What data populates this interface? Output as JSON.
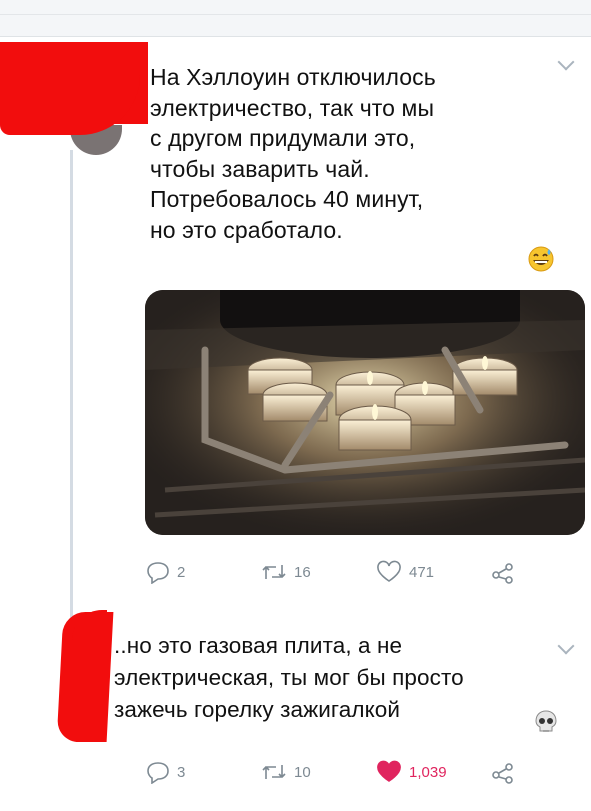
{
  "tweet1": {
    "text_lines": [
      "На Хэллоуин отключилось",
      "электричество, так что мы",
      "с другом придумали это,",
      "чтобы заварить чай.",
      "Потребовалось 40 минут,",
      "но это сработало."
    ],
    "emoji": "grinning-sweat-emoji",
    "stats": {
      "replies": "2",
      "retweets": "16",
      "likes": "471"
    }
  },
  "tweet2": {
    "text_lines": [
      "..но это газовая плита, а не",
      "электрическая, ты мог бы просто",
      "зажечь горелку зажигалкой"
    ],
    "emoji": "skull-emoji",
    "stats": {
      "replies": "3",
      "retweets": "10",
      "likes": "1,039"
    }
  },
  "colors": {
    "redaction": "#f20d0d",
    "like_active": "#e0245e",
    "icon_gray": "#7d8992"
  },
  "icons": [
    "reply-icon",
    "retweet-icon",
    "like-icon",
    "share-icon",
    "caret-down-icon"
  ]
}
